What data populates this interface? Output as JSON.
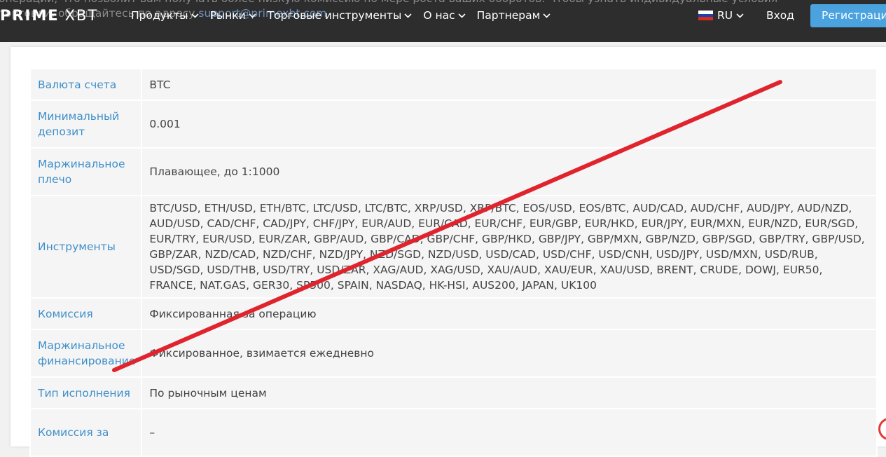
{
  "header": {
    "underlay_line1": "операций, что позволит вам получать более низкую комиссию по мере роста ваших оборотов. Чтобы узнать индивидуальные условия",
    "underlay_line2_pre": "торговли, обращайтесь по адресу",
    "underlay_link": "support@primexbt.com",
    "logo_prime": "PRIME",
    "logo_xbt": "XBT",
    "nav": [
      {
        "label": "Продукты"
      },
      {
        "label": "Рынки"
      },
      {
        "label": "Торговые инструменты"
      },
      {
        "label": "О нас"
      },
      {
        "label": "Партнерам"
      }
    ],
    "lang": "RU",
    "login": "Вход",
    "register": "Регистрация"
  },
  "specs": [
    {
      "label": "Валюта счета",
      "value": "BTC"
    },
    {
      "label": "Минимальный депозит",
      "value": "0.001"
    },
    {
      "label": "Маржинальное плечо",
      "value": "Плавающее, до 1:1000"
    },
    {
      "label": "Инструменты",
      "value": "BTC/USD, ETH/USD, ETH/BTC, LTC/USD, LTC/BTC, XRP/USD, XRP/BTC, EOS/USD, EOS/BTC, AUD/CAD, AUD/CHF, AUD/JPY, AUD/NZD, AUD/USD, CAD/CHF, CAD/JPY, CHF/JPY, EUR/AUD, EUR/CAD, EUR/CHF, EUR/GBP, EUR/HKD, EUR/JPY, EUR/MXN, EUR/NZD, EUR/SGD, EUR/TRY, EUR/USD, EUR/ZAR, GBP/AUD, GBP/CAD, GBP/CHF, GBP/HKD, GBP/JPY, GBP/MXN, GBP/NZD, GBP/SGD, GBP/TRY, GBP/USD, GBP/ZAR, NZD/CAD, NZD/CHF, NZD/JPY, NZD/SGD, NZD/USD, USD/CAD, USD/CHF, USD/CNH, USD/JPY, USD/MXN, USD/RUB, USD/SGD, USD/THB, USD/TRY, USD/ZAR, XAG/AUD, XAG/USD, XAU/AUD, XAU/EUR, XAU/USD, BRENT, CRUDE, DOWJ, EUR50, FRANCE, NAT.GAS, GER30, SP500, SPAIN, NASDAQ, HK-HSI, AUS200, JAPAN, UK100"
    },
    {
      "label": "Комиссия",
      "value": "Фиксированная за операцию"
    },
    {
      "label": "Маржинальное финансирование",
      "value": "Фиксированное, взимается ежедневно"
    },
    {
      "label": "Тип исполнения",
      "value": "По рыночным ценам"
    },
    {
      "label": "Комиссия за",
      "value": "–"
    }
  ],
  "colors": {
    "header_bg": "#2d2d2d",
    "accent_blue": "#4aa3df",
    "label_blue": "#3f8fc9",
    "strike_red": "#e0242e"
  }
}
